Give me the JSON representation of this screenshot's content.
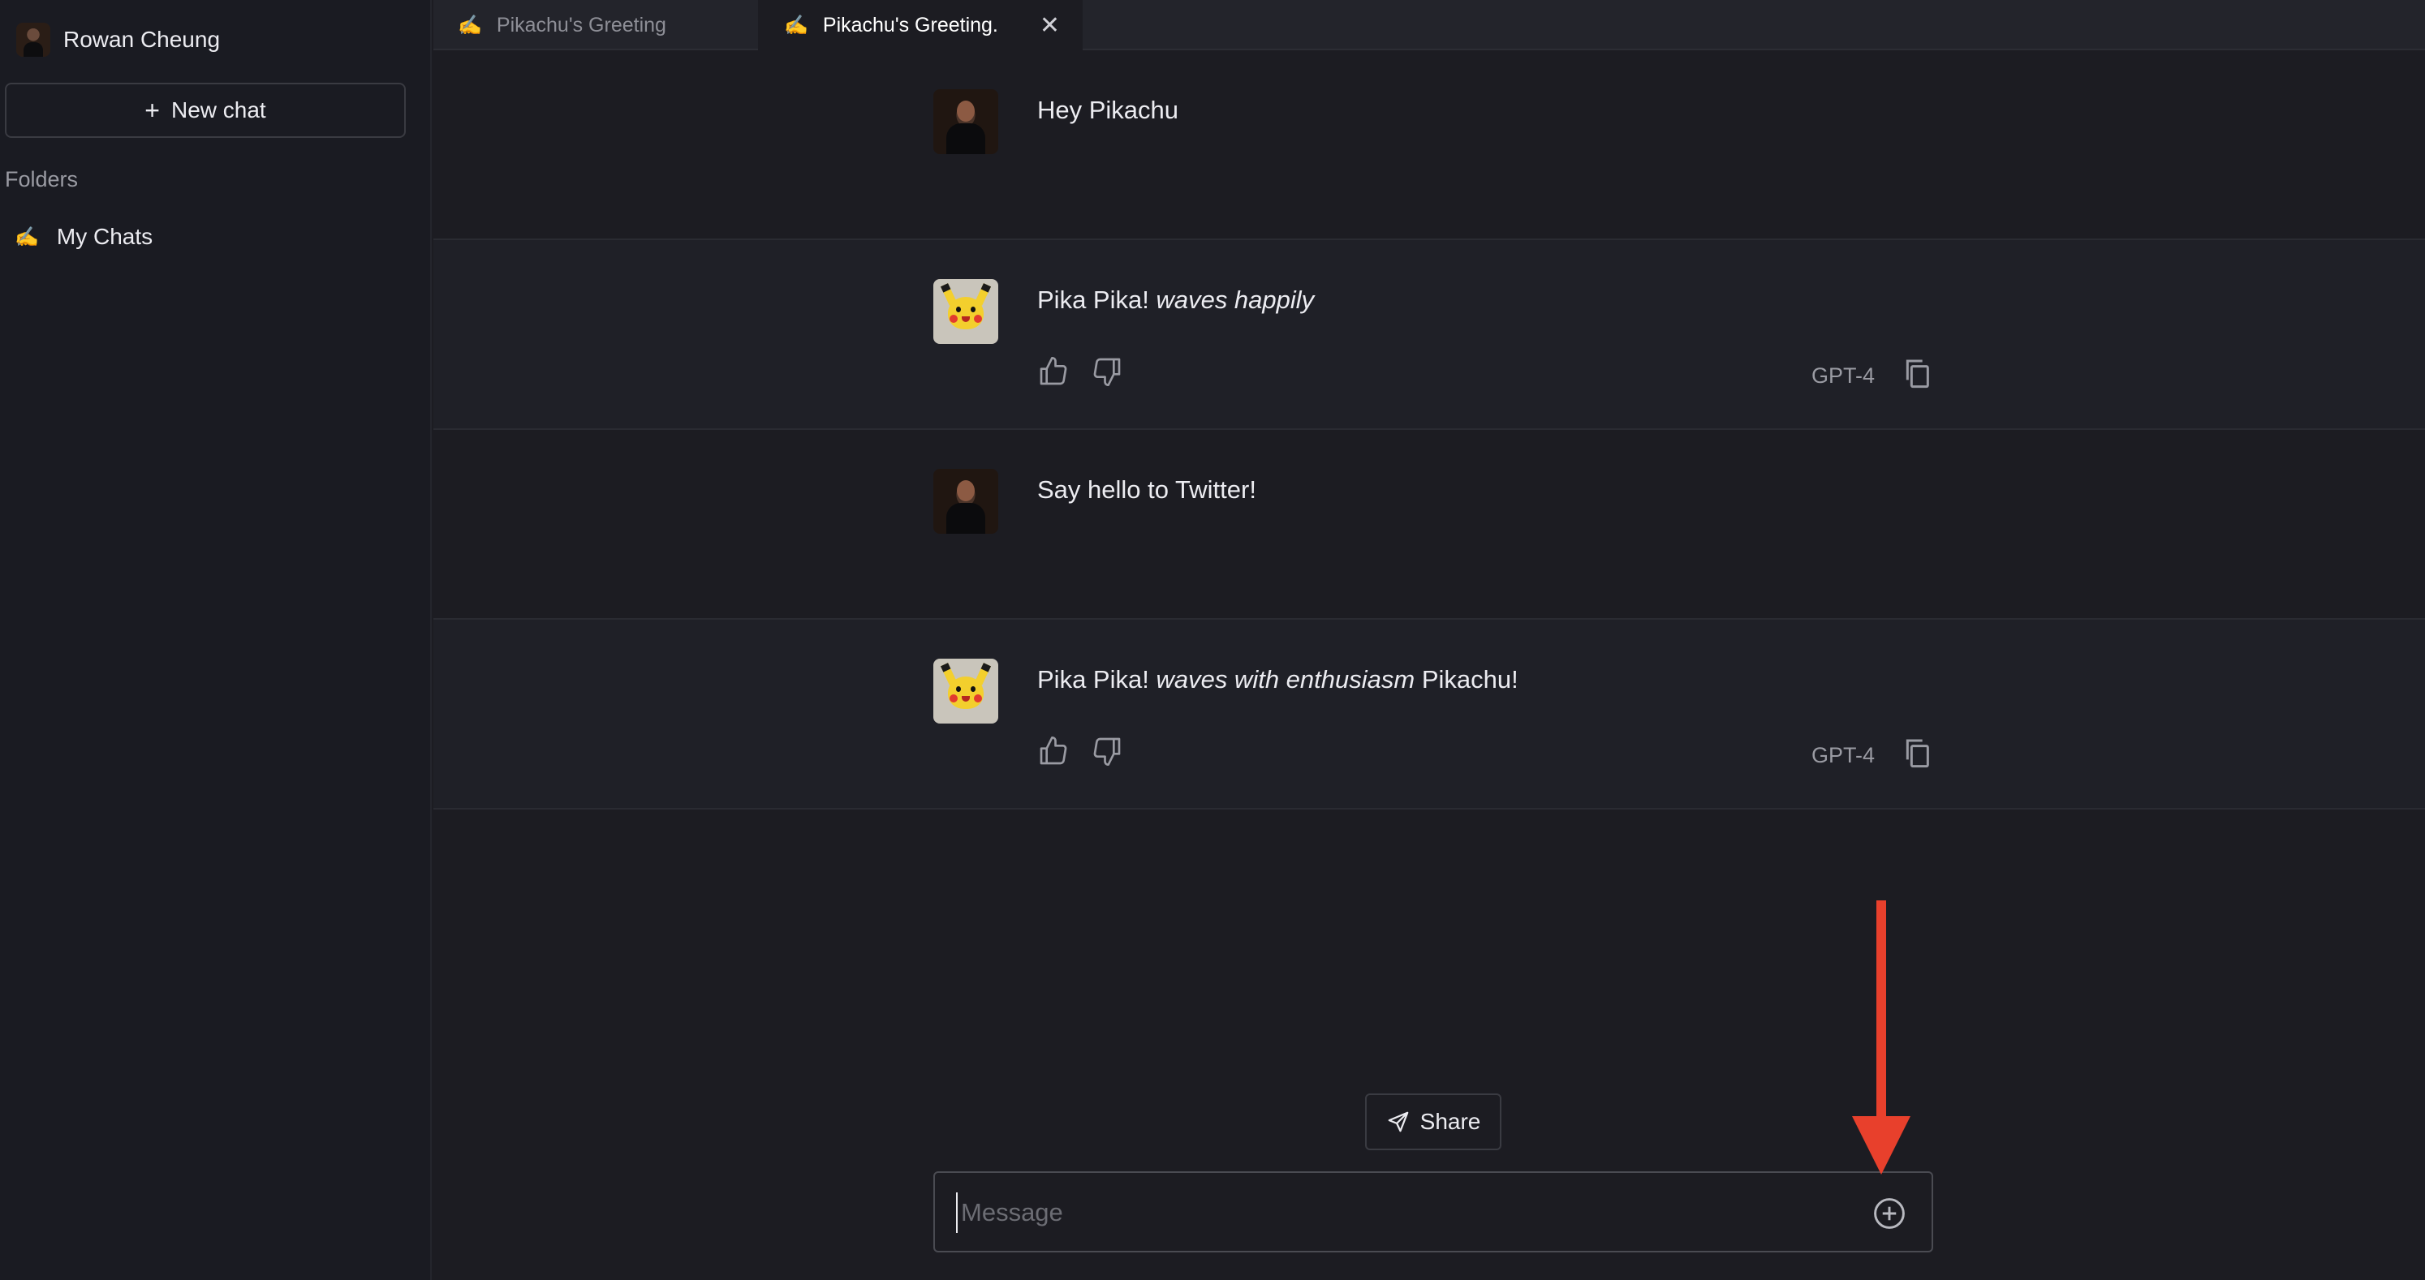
{
  "sidebar": {
    "user_name": "Rowan Cheung",
    "new_chat_label": "New chat",
    "folders_label": "Folders",
    "folder_items": [
      {
        "emoji": "✍️",
        "label": "My Chats"
      }
    ]
  },
  "tabs": [
    {
      "emoji": "✍️",
      "label": "Pikachu's Greeting"
    },
    {
      "emoji": "✍️",
      "label": "Pikachu's Greeting."
    }
  ],
  "messages": [
    {
      "role": "user",
      "text": "Hey Pikachu"
    },
    {
      "role": "assistant",
      "text_before": "Pika Pika! ",
      "text_italic": "waves happily",
      "text_after": "",
      "model": "GPT-4"
    },
    {
      "role": "user",
      "text": "Say hello to Twitter!"
    },
    {
      "role": "assistant",
      "text_before": "Pika Pika! ",
      "text_italic": "waves with enthusiasm",
      "text_after": " Pikachu!",
      "model": "GPT-4"
    }
  ],
  "composer": {
    "share_label": "Share",
    "placeholder": "Message"
  },
  "colors": {
    "background": "#1c1c22",
    "sidebar": "#1a1b22",
    "annotation_arrow": "#e8402c"
  },
  "icons": [
    "plus-icon",
    "close-icon",
    "thumbs-up-icon",
    "thumbs-down-icon",
    "copy-icon",
    "send-icon",
    "plus-circle-icon",
    "annotation-arrow"
  ]
}
